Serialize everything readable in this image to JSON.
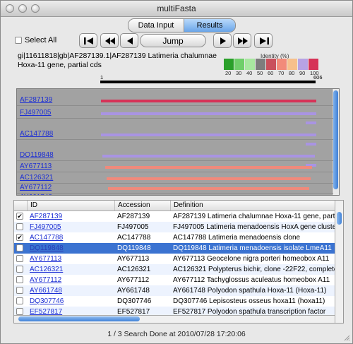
{
  "window": {
    "title": "multiFasta"
  },
  "tabs": {
    "data_input": "Data Input",
    "results": "Results"
  },
  "controls": {
    "select_all": "Select All",
    "jump": "Jump"
  },
  "sequence": {
    "line1": "gi|11611818|gb|AF287139.1|AF287139 Latimeria chalumnae",
    "line2": "Hoxa-11 gene, partial cds",
    "start": "1",
    "end": "606"
  },
  "identity": {
    "title": "Identity (%)",
    "labels": [
      "20",
      "30",
      "40",
      "50",
      "60",
      "70",
      "80",
      "90",
      "100"
    ],
    "colors": [
      "#2aa02a",
      "#6fcf6a",
      "#a8e8a0",
      "#7d7d7d",
      "#c9505c",
      "#f28b7a",
      "#f7c08c",
      "#b7a3e4",
      "#d63357"
    ]
  },
  "alignment": {
    "rows": [
      {
        "accession": "AF287139",
        "color": "#d63357"
      },
      {
        "accession": "FJ497005",
        "color": "#a994e3"
      },
      {
        "accession": "AC147788",
        "color": "#a994e3"
      },
      {
        "accession": "DQ119848",
        "color": "#a994e3"
      },
      {
        "accession": "AY677113",
        "color": "#f08a7c"
      },
      {
        "accession": "AC126321",
        "color": "#f08a7c"
      },
      {
        "accession": "AY677112",
        "color": "#f08a7c"
      },
      {
        "accession": "AY661748",
        "color": "#f08a7c"
      }
    ]
  },
  "table": {
    "headers": {
      "id": "ID",
      "accession": "Accession",
      "definition": "Definition"
    },
    "rows": [
      {
        "checked": true,
        "id": "AF287139",
        "accession": "AF287139",
        "definition": "AF287139 Latimeria chalumnae Hoxa-11 gene, partial"
      },
      {
        "checked": false,
        "id": "FJ497005",
        "accession": "FJ497005",
        "definition": "FJ497005 Latimeria menadoensis HoxA gene cluster,"
      },
      {
        "checked": true,
        "id": "AC147788",
        "accession": "AC147788",
        "definition": "AC147788 Latimeria menadoensis clone"
      },
      {
        "checked": true,
        "id": "DQ119848",
        "accession": "DQ119848",
        "definition": "DQ119848 Latimeria menadoensis isolate LmeA11",
        "selected": true
      },
      {
        "checked": false,
        "id": "AY677113",
        "accession": "AY677113",
        "definition": "AY677113 Geocelone nigra porteri homeobox A11"
      },
      {
        "checked": false,
        "id": "AC126321",
        "accession": "AC126321",
        "definition": "AC126321 Polypterus bichir, clone -22F22, complete"
      },
      {
        "checked": false,
        "id": "AY677112",
        "accession": "AY677112",
        "definition": "AY677112 Tachyglossus aculeatus homeobox A11"
      },
      {
        "checked": false,
        "id": "AY661748",
        "accession": "AY661748",
        "definition": "AY661748 Polyodon spathula Hoxa-11 (Hoxa-11)"
      },
      {
        "checked": false,
        "id": "DQ307746",
        "accession": "DQ307746",
        "definition": "DQ307746 Lepisosteus osseus hoxa11 (hoxa11)"
      },
      {
        "checked": false,
        "id": "EF527817",
        "accession": "EF527817",
        "definition": "EF527817 Polyodon spathula transcription factor"
      }
    ]
  },
  "status": {
    "text": "1 / 3   Search Done at 2010/07/28 17:20:06"
  }
}
